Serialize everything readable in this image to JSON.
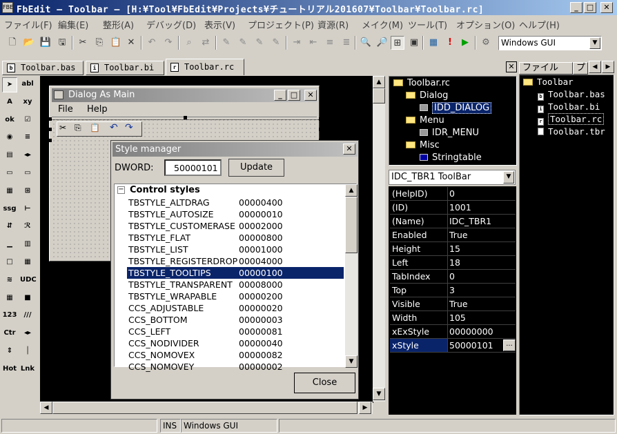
{
  "window": {
    "title": "FbEdit – Toolbar – [H:¥Tool¥FbEdit¥Projects¥チュートリアル201607¥Toolbar¥Toolbar.rc]",
    "app_icon": "FBE",
    "min": "_",
    "max": "□",
    "close": "✕"
  },
  "menu": [
    "ファイル(F)",
    "編集(E)",
    "整形(A)",
    "デバッグ(D)",
    "表示(V)",
    "プロジェクト(P)",
    "資源(R)",
    "メイク(M)",
    "ツール(T)",
    "オプション(O)",
    "ヘルプ(H)"
  ],
  "toolbar": {
    "build_combo": "Windows GUI"
  },
  "tabs": [
    {
      "label": "Toolbar.bas",
      "icon": "b"
    },
    {
      "label": "Toolbar.bi",
      "icon": "i"
    },
    {
      "label": "Toolbar.rc",
      "icon": "r"
    }
  ],
  "palette": [
    "arrow-icon",
    "abl",
    "A",
    "xy",
    "ok",
    "☑",
    "◉",
    "≡",
    "▤",
    "◂▸",
    "▭",
    "▭",
    "▦",
    "⊞",
    "ssg",
    "⊢",
    "⇵",
    "ℛ",
    "▁",
    "▥",
    "□",
    "▦",
    "≋",
    "UDC",
    "▦",
    "■",
    "123",
    "///",
    "Ctr",
    "◂▸",
    "⇕",
    "│",
    "Hot",
    "Lnk"
  ],
  "dialog": {
    "title": "Dialog As Main",
    "menu": [
      "File",
      "Help"
    ]
  },
  "style_manager": {
    "title": "Style manager",
    "dword_label": "DWORD:",
    "dword_value": "50000101",
    "update": "Update",
    "group": "Control styles",
    "rows": [
      {
        "name": "TBSTYLE_ALTDRAG",
        "value": "00000400"
      },
      {
        "name": "TBSTYLE_AUTOSIZE",
        "value": "00000010"
      },
      {
        "name": "TBSTYLE_CUSTOMERASE",
        "value": "00002000"
      },
      {
        "name": "TBSTYLE_FLAT",
        "value": "00000800"
      },
      {
        "name": "TBSTYLE_LIST",
        "value": "00001000"
      },
      {
        "name": "TBSTYLE_REGISTERDROP",
        "value": "00004000"
      },
      {
        "name": "TBSTYLE_TOOLTIPS",
        "value": "00000100",
        "selected": true
      },
      {
        "name": "TBSTYLE_TRANSPARENT",
        "value": "00008000"
      },
      {
        "name": "TBSTYLE_WRAPABLE",
        "value": "00000200"
      },
      {
        "name": "CCS_ADJUSTABLE",
        "value": "00000020"
      },
      {
        "name": "CCS_BOTTOM",
        "value": "00000003"
      },
      {
        "name": "CCS_LEFT",
        "value": "00000081"
      },
      {
        "name": "CCS_NODIVIDER",
        "value": "00000040"
      },
      {
        "name": "CCS_NOMOVEX",
        "value": "00000082"
      },
      {
        "name": "CCS_NOMOVEY",
        "value": "00000002"
      }
    ],
    "close": "Close"
  },
  "resource_tree": {
    "root": "Toolbar.rc",
    "items": [
      {
        "label": "Dialog",
        "level": 1
      },
      {
        "label": "IDD_DIALOG",
        "level": 2,
        "selected": true
      },
      {
        "label": "Menu",
        "level": 1
      },
      {
        "label": "IDR_MENU",
        "level": 2
      },
      {
        "label": "Misc",
        "level": 1
      },
      {
        "label": "Stringtable",
        "level": 2
      }
    ]
  },
  "properties": {
    "combo": "IDC_TBR1 ToolBar",
    "rows": [
      {
        "k": "(HelpID)",
        "v": "0"
      },
      {
        "k": "(ID)",
        "v": "1001"
      },
      {
        "k": "(Name)",
        "v": "IDC_TBR1"
      },
      {
        "k": "Enabled",
        "v": "True"
      },
      {
        "k": "Height",
        "v": "15"
      },
      {
        "k": "Left",
        "v": "18"
      },
      {
        "k": "TabIndex",
        "v": "0"
      },
      {
        "k": "Top",
        "v": "3"
      },
      {
        "k": "Visible",
        "v": "True"
      },
      {
        "k": "Width",
        "v": "105"
      },
      {
        "k": "xExStyle",
        "v": "00000000"
      },
      {
        "k": "xStyle",
        "v": "50000101",
        "selected": true
      }
    ],
    "ellipsis": "..."
  },
  "project": {
    "tab_file": "ファイル",
    "tab_proj": "プ",
    "root": "Toolbar",
    "files": [
      {
        "label": "Toolbar.bas",
        "icon": "b"
      },
      {
        "label": "Toolbar.bi",
        "icon": "i"
      },
      {
        "label": "Toolbar.rc",
        "icon": "r",
        "selected": true
      },
      {
        "label": "Toolbar.tbr",
        "icon": ""
      }
    ]
  },
  "status": {
    "ins": "INS",
    "build": "Windows GUI"
  }
}
